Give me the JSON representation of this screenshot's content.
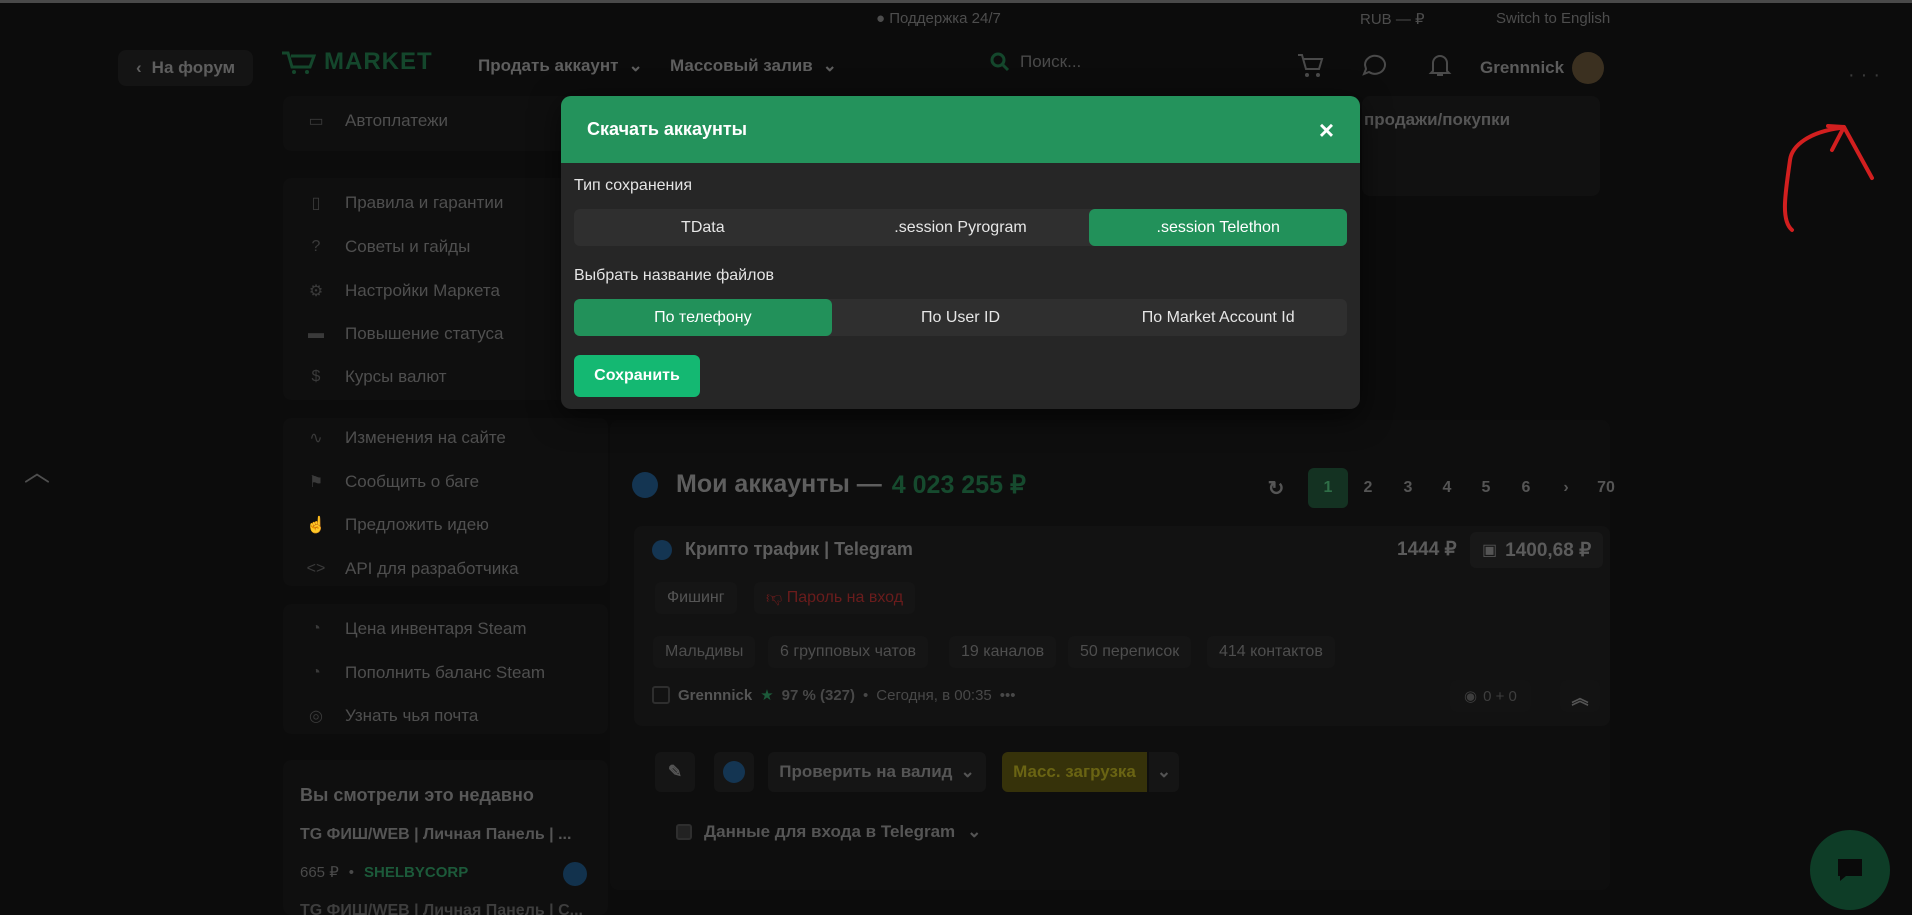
{
  "util": {
    "support": "Поддержка 24/7",
    "currency": "RUB — ₽",
    "lang": "Switch to English"
  },
  "header": {
    "back": "На форум",
    "logo": "MARKET",
    "sell": "Продать аккаунт",
    "mass": "Массовый залив",
    "search_placeholder": "Поиск...",
    "username": "Grennnick"
  },
  "sidebar": {
    "items": [
      {
        "label": "Автоплатежи",
        "icon": "chat-icon"
      },
      {
        "label": "Правила и гарантии",
        "icon": "tablet-icon"
      },
      {
        "label": "Советы и гайды",
        "icon": "help-icon"
      },
      {
        "label": "Настройки Маркета",
        "icon": "gear-icon"
      },
      {
        "label": "Повышение статуса",
        "icon": "truck-icon"
      },
      {
        "label": "Курсы валют",
        "icon": "dollar-icon"
      },
      {
        "label": "Изменения на сайте",
        "icon": "pulse-icon"
      },
      {
        "label": "Сообщить о баге",
        "icon": "flag-icon"
      },
      {
        "label": "Предложить идею",
        "icon": "thumbs-up-icon"
      },
      {
        "label": "API для разработчика",
        "icon": "code-icon"
      },
      {
        "label": "Цена инвентаря Steam",
        "icon": "steam-icon"
      },
      {
        "label": "Пополнить баланс Steam",
        "icon": "steam-icon"
      },
      {
        "label": "Узнать чья почта",
        "icon": "mail-search-icon"
      }
    ],
    "recent_title": "Вы смотрели это недавно",
    "recent_item": "TG ФИШ/WEB | Личная Панель | ...",
    "recent_price": "665 ₽",
    "recent_seller": "SHELBYCORP",
    "recent_item2": "TG ФИШ/WEB | Личная Панель | С..."
  },
  "top_panel": {
    "text": "продажи/покупки"
  },
  "main": {
    "title": "Мои аккаунты —",
    "total": "4 023 255 ₽",
    "pages": [
      "1",
      "2",
      "3",
      "4",
      "5",
      "6",
      "70"
    ],
    "card": {
      "title": "Крипто трафик | Telegram",
      "price": "1444 ₽",
      "price2": "1400,68 ₽",
      "tag1": "Фишинг",
      "tag2": "Пароль на вход",
      "chips": [
        "Мальдивы",
        "6 групповых чатов",
        "19 каналов",
        "50 переписок",
        "414 контактов"
      ],
      "seller": "Grennnick",
      "rating": "97 % (327)",
      "time": "Сегодня, в 00:35",
      "views": "0 + 0"
    },
    "check_valid": "Проверить на валид",
    "mass_upload": "Масс. загрузка",
    "tg_data": "Данные для входа в Telegram"
  },
  "modal": {
    "title": "Скачать аккаунты",
    "close": "×",
    "save_type_label": "Тип сохранения",
    "save_types": [
      "TData",
      ".session Pyrogram",
      ".session Telethon"
    ],
    "save_type_selected": ".session Telethon",
    "filename_label": "Выбрать название файлов",
    "filenames": [
      "По телефону",
      "По User ID",
      "По Market Account Id"
    ],
    "filename_selected": "По телефону",
    "save_button": "Сохранить"
  },
  "colors": {
    "accent": "#24935c",
    "save": "#14b872",
    "annotation": "#d21f1f"
  }
}
